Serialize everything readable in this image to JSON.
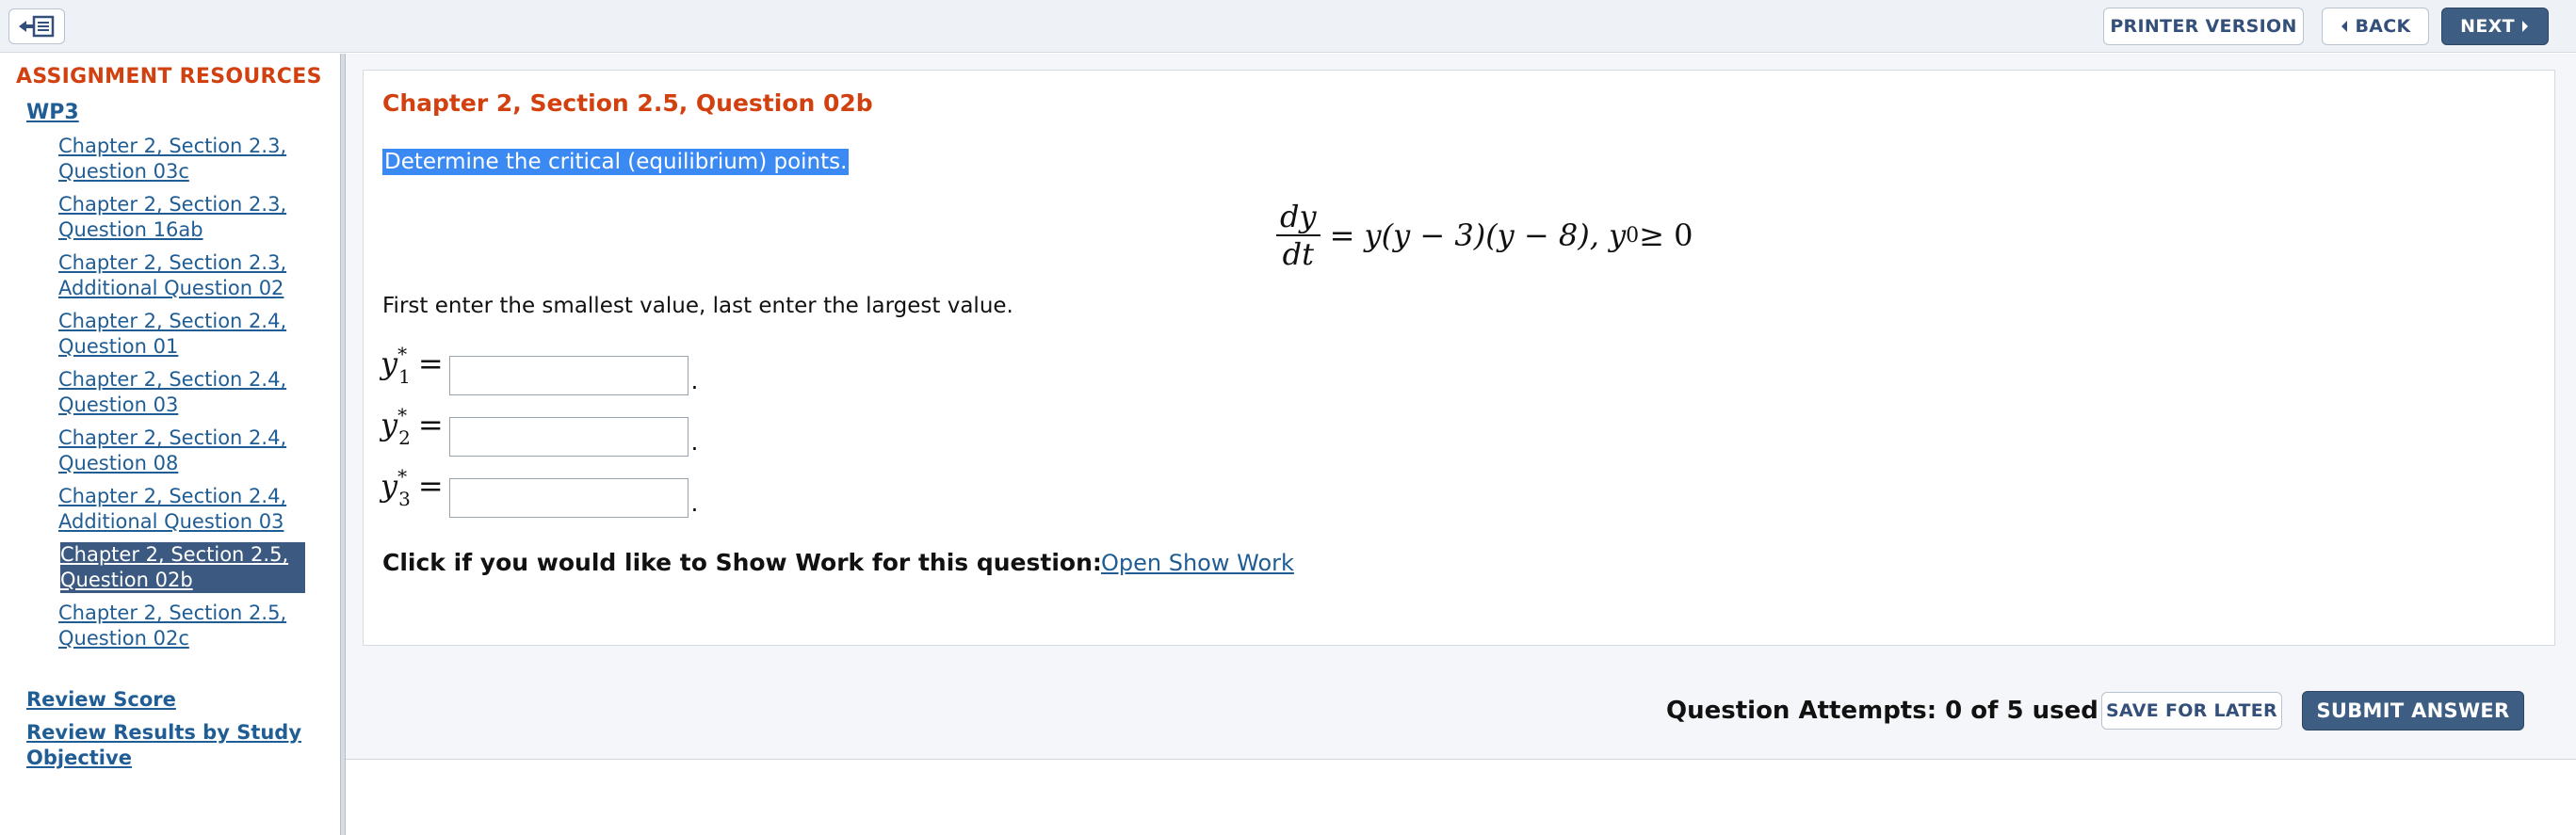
{
  "toolbar": {
    "collapse_icon": "collapse-sidebar-icon",
    "printer_label": "PRINTER VERSION",
    "back_label": "BACK",
    "next_label": "NEXT"
  },
  "sidebar": {
    "title": "ASSIGNMENT RESOURCES",
    "group_label": "WP3",
    "items": [
      {
        "line1": "Chapter 2, Section 2.3,",
        "line2": "Question 03c"
      },
      {
        "line1": "Chapter 2, Section 2.3,",
        "line2": "Question 16ab"
      },
      {
        "line1": "Chapter 2, Section 2.3,",
        "line2": "Additional Question 02"
      },
      {
        "line1": "Chapter 2, Section 2.4,",
        "line2": "Question 01"
      },
      {
        "line1": "Chapter 2, Section 2.4,",
        "line2": "Question 03"
      },
      {
        "line1": "Chapter 2, Section 2.4,",
        "line2": "Question 08"
      },
      {
        "line1": "Chapter 2, Section 2.4,",
        "line2": "Additional Question 03"
      },
      {
        "line1": "Chapter 2, Section 2.5,",
        "line2": "Question 02b"
      },
      {
        "line1": "Chapter 2, Section 2.5,",
        "line2": "Question 02c"
      }
    ],
    "active_index": 7,
    "review_score": "Review Score",
    "review_results": [
      "Review Results by Study",
      "Objective"
    ]
  },
  "question": {
    "title": "Chapter 2, Section 2.5, Question 02b",
    "prompt": "Determine the critical (equilibrium) points.",
    "equation": {
      "num": "dy",
      "den": "dt",
      "rhs": "= y(y − 3)(y − 8),  y",
      "sub": "0",
      "cond": " ≥ 0"
    },
    "instructions": "First enter the smallest value, last enter the largest value.",
    "answers": [
      {
        "var": "y",
        "sup": "*",
        "sub": "1",
        "value": ""
      },
      {
        "var": "y",
        "sup": "*",
        "sub": "2",
        "value": ""
      },
      {
        "var": "y",
        "sup": "*",
        "sub": "3",
        "value": ""
      }
    ],
    "show_work_label": "Click if you would like to Show Work for this question:",
    "show_work_link": "Open Show Work"
  },
  "footer": {
    "attempts": "Question Attempts: 0 of 5 used",
    "save_label": "SAVE FOR LATER",
    "submit_label": "SUBMIT ANSWER"
  }
}
